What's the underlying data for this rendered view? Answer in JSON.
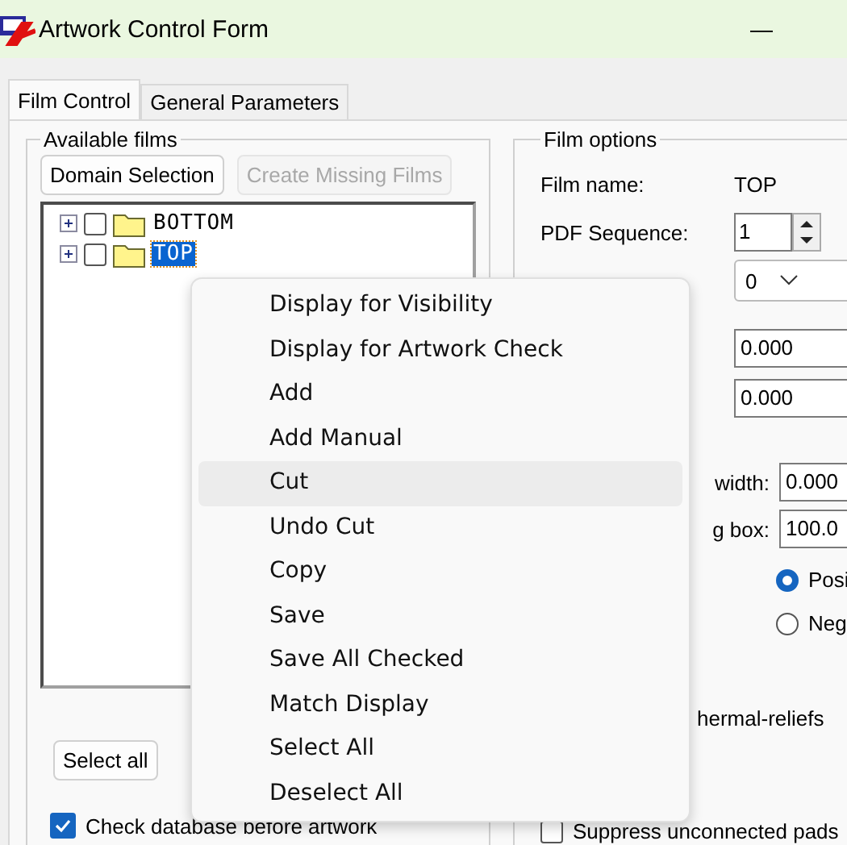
{
  "window": {
    "title": "Artwork Control Form",
    "minimize": "—"
  },
  "tabs": [
    {
      "label": "Film Control",
      "selected": true
    },
    {
      "label": "General Parameters",
      "selected": false
    }
  ],
  "available_films": {
    "title": "Available films",
    "buttons": [
      {
        "label": "Domain Selection",
        "disabled": false
      },
      {
        "label": "Create Missing Films",
        "disabled": true
      }
    ],
    "tree": [
      {
        "label": "BOTTOM",
        "checked": false,
        "selected": false
      },
      {
        "label": "TOP",
        "checked": false,
        "selected": true
      }
    ],
    "select_all_button": "Select all",
    "check_database": {
      "label": "Check database before artwork",
      "checked": true
    }
  },
  "film_options": {
    "title": "Film options",
    "film_name_label": "Film name:",
    "film_name": "TOP",
    "pdf_sequence_label": "PDF Sequence:",
    "pdf_sequence": "1",
    "dropdown_value": "0",
    "field_1": "0.000",
    "field_2": "0.000",
    "width_label": "width:",
    "width_value": "0.000",
    "box_label": "g box:",
    "box_value": "100.0",
    "polarity": [
      {
        "label": "Posi",
        "selected": true
      },
      {
        "label": "Neg",
        "selected": false
      }
    ],
    "thermal_label": "hermal-reliefs",
    "suppress": {
      "label": "Suppress unconnected pads",
      "checked": false
    }
  },
  "context_menu": [
    {
      "label": "Display for Visibility",
      "hovered": false
    },
    {
      "label": "Display for Artwork Check",
      "hovered": false
    },
    {
      "label": "Add",
      "hovered": false
    },
    {
      "label": "Add Manual",
      "hovered": false
    },
    {
      "label": "Cut",
      "hovered": true
    },
    {
      "label": "Undo Cut",
      "hovered": false
    },
    {
      "label": "Copy",
      "hovered": false
    },
    {
      "label": "Save",
      "hovered": false
    },
    {
      "label": "Save All Checked",
      "hovered": false
    },
    {
      "label": "Match Display",
      "hovered": false
    },
    {
      "label": "Select All",
      "hovered": false
    },
    {
      "label": "Deselect All",
      "hovered": false
    }
  ]
}
